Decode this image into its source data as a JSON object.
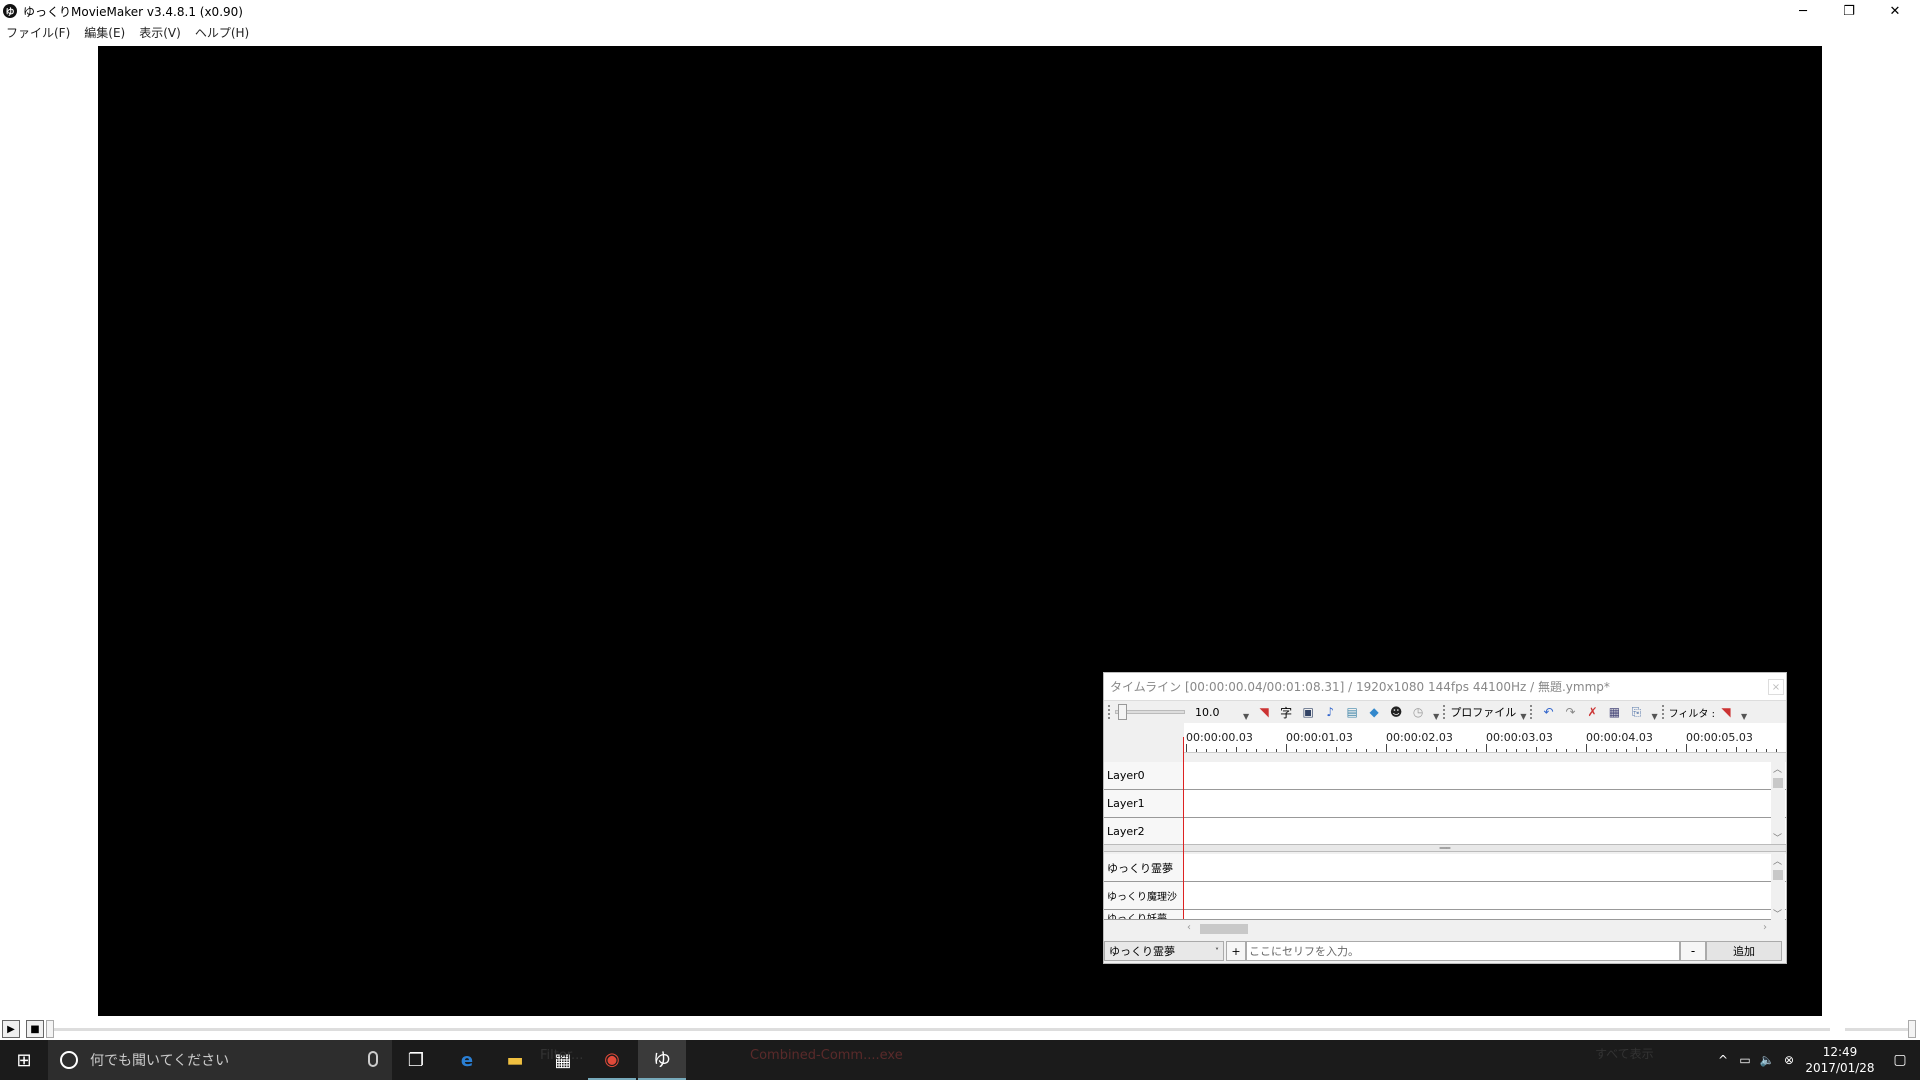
{
  "window": {
    "app_icon_char": "ゆ",
    "title": "ゆっくりMovieMaker v3.4.8.1 (x0.90)",
    "minimize": "─",
    "restore": "❐",
    "close": "✕"
  },
  "menu": [
    "ファイル(F)",
    "編集(E)",
    "表示(V)",
    "ヘルプ(H)"
  ],
  "timeline": {
    "title": "タイムライン [00:00:00.04/00:01:08.31] / 1920x1080 144fps 44100Hz / 無題.ymmp*",
    "close": "×",
    "zoom_value": "10.0",
    "profile_label": "プロファイル",
    "filter_label": "フィルタ :",
    "ruler_labels": [
      "00:00:00.03",
      "00:00:01.03",
      "00:00:02.03",
      "00:00:03.03",
      "00:00:04.03",
      "00:00:05.03"
    ],
    "layers": [
      "Layer0",
      "Layer1",
      "Layer2"
    ],
    "characters": [
      "ゆっくり霊夢",
      "ゆっくり魔理沙",
      "ゆっくり妖夢"
    ],
    "splitter_grip": "═══",
    "char_select": "ゆっくり霊夢",
    "char_select_arrow": "˅",
    "plus": "+",
    "serif_placeholder": "ここにセリフを入力。",
    "minus": "-",
    "add": "追加"
  },
  "playbar": {
    "play": "▶",
    "stop": "■"
  },
  "taskbar": {
    "start": "⊞",
    "search_placeholder": "何でも聞いてください",
    "ghost_items": [
      "Combined-Comm....exe",
      "Filter...",
      "すべて表示"
    ],
    "time": "12:49",
    "date": "2017/01/28"
  }
}
